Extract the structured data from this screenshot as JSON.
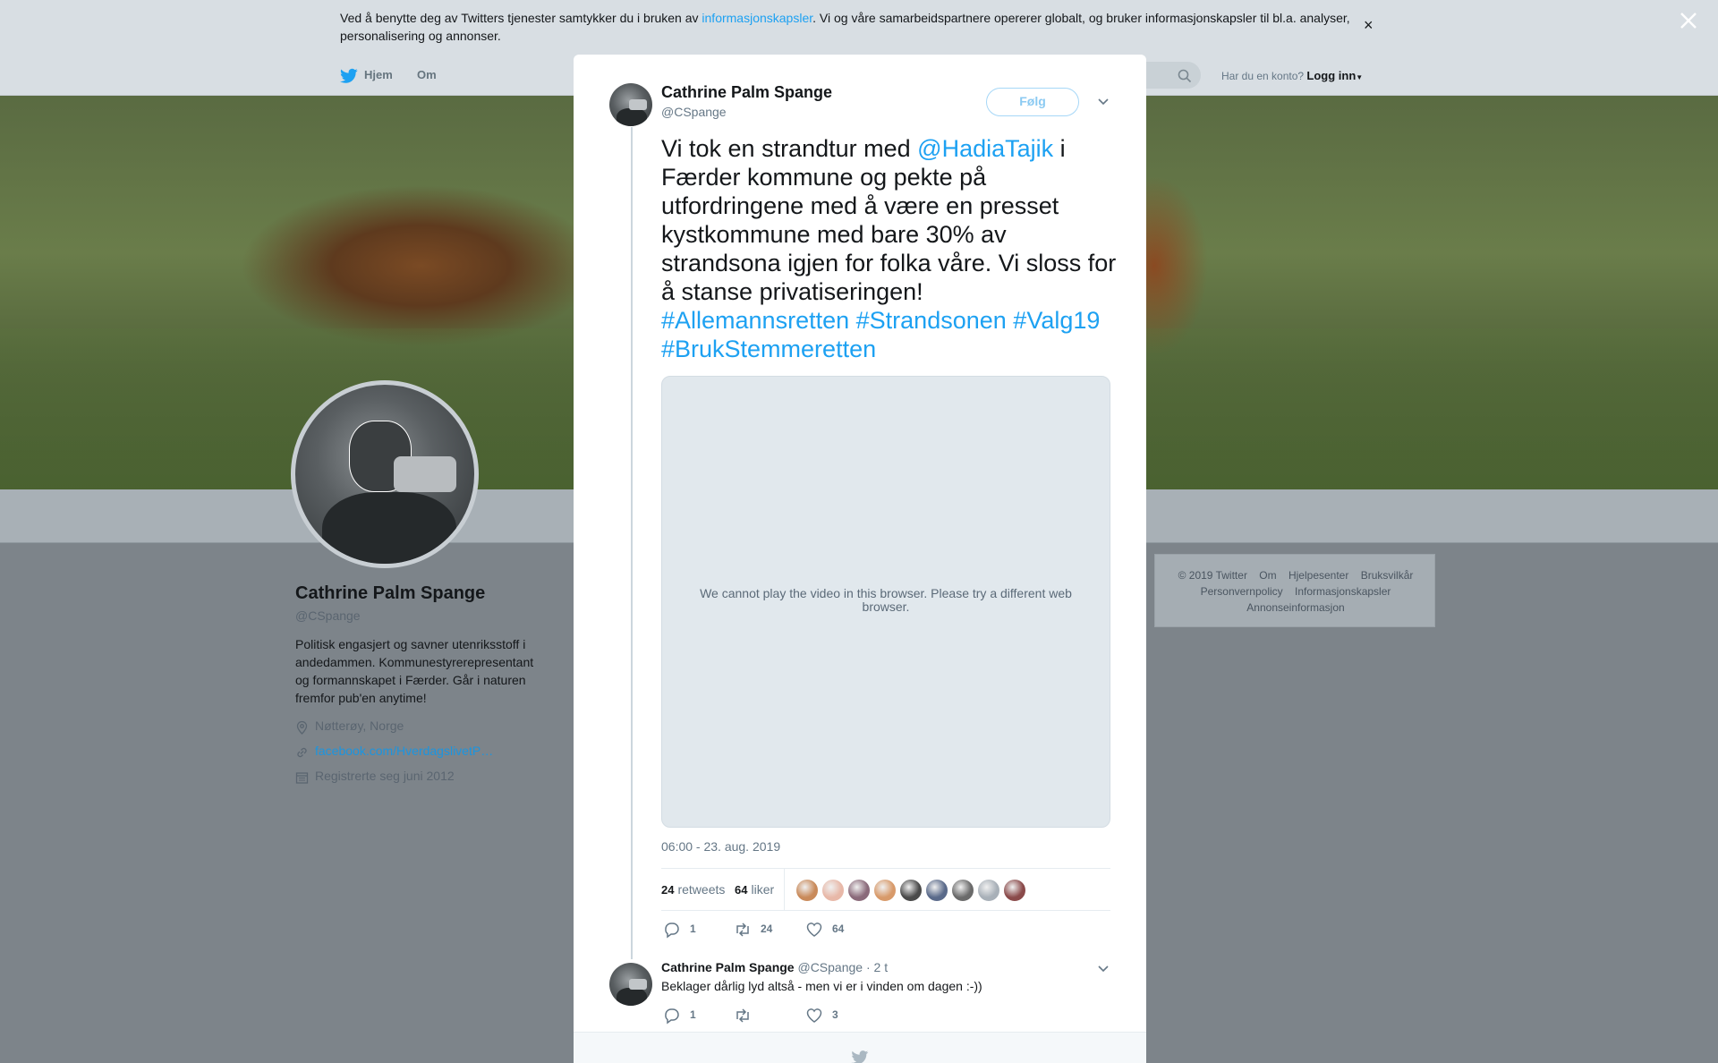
{
  "cookie_banner": {
    "text_before": "Ved å benytte deg av Twitters tjenester samtykker du i bruken av ",
    "link": "informasjonskapsler",
    "text_after": ". Vi og våre samarbeidspartnere opererer globalt, og bruker informasjonskapsler til bl.a. analyser, personalisering og annonser.",
    "close": "×"
  },
  "nav": {
    "logo_icon": "twitter-bird-icon",
    "home": "Hjem",
    "about": "Om",
    "account_prompt": "Har du en konto?",
    "login": "Logg inn"
  },
  "profile": {
    "name": "Cathrine Palm Spange",
    "handle": "@CSpange",
    "bio": "Politisk engasjert og savner utenriksstoff i andedammen. Kommunestyrerepresentant og formannskapet i Færder. Går i naturen fremfor pub'en anytime!",
    "location": "Nøtterøy, Norge",
    "url": "facebook.com/HverdagslivetP…",
    "joined": "Registrerte seg juni 2012"
  },
  "footer": {
    "links_row1": [
      "© 2019 Twitter",
      "Om",
      "Hjelpesenter",
      "Bruksvilkår"
    ],
    "links_row2": [
      "Personvernpolicy",
      "Informasjonskapsler"
    ],
    "links_row3": [
      "Annonseinformasjon"
    ]
  },
  "tweet": {
    "name": "Cathrine Palm Spange",
    "handle": "@CSpange",
    "follow": "Følg",
    "text_1": "Vi tok en strandtur med ",
    "mention": "@HadiaTajik",
    "text_2": " i Færder kommune og pekte på utfordringene med å være en presset kystkommune med bare 30% av strandsona igjen for folka våre. Vi sloss for å stanse privatiseringen! ",
    "hashtags": [
      "#Allemannsretten",
      "#Strandsonen",
      "#Valg19",
      "#BrukStemmeretten"
    ],
    "video_message": "We cannot play the video in this browser. Please try a different web browser.",
    "timestamp": "06:00 - 23. aug. 2019",
    "retweets_count": "24",
    "retweets_label": "retweets",
    "likes_count": "64",
    "likes_label": "liker",
    "actions": {
      "replies": "1",
      "retweets": "24",
      "likes": "64"
    },
    "liker_face_colors": [
      "#c98a5a",
      "#e8b8a8",
      "#8a6a7a",
      "#d89a6a",
      "#4a4a4a",
      "#5a6a8a",
      "#6a6a6a",
      "#a8b0b8",
      "#8a4a4a"
    ]
  },
  "reply": {
    "name": "Cathrine Palm Spange",
    "handle": "@CSpange",
    "separator": "·",
    "time": "2 t",
    "text": "Beklager dårlig lyd altså - men vi er i vinden om dagen :-))",
    "actions": {
      "replies": "1",
      "likes": "3"
    }
  }
}
